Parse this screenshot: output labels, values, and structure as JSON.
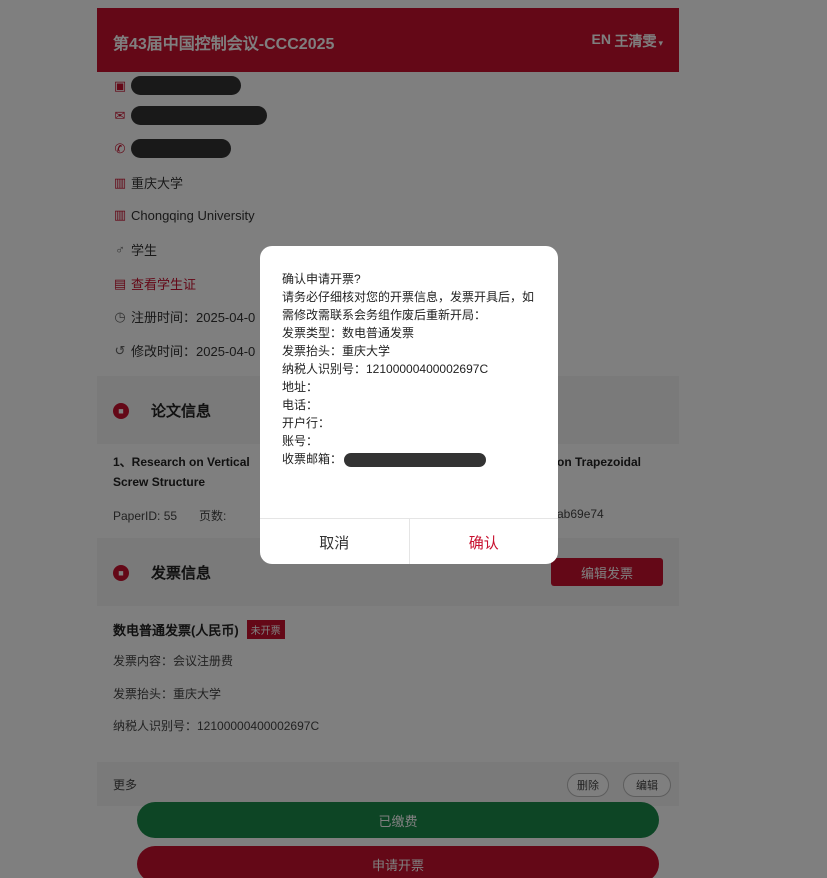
{
  "header": {
    "title": "第43届中国控制会议-CCC2025",
    "lang": "EN",
    "user": "王清雯",
    "caret": "▾"
  },
  "profile": {
    "affiliation_cn": "重庆大学",
    "affiliation_en": "Chongqing University",
    "role": "学生",
    "student_id_link": "查看学生证",
    "registered_time": "注册时间：2025-04-0",
    "modified_time": "修改时间：2025-04-0"
  },
  "paper": {
    "section_title": "论文信息",
    "title_line1": "1、Research on Vertical",
    "title_line1_right": "on Trapezoidal",
    "title_line2": "Screw Structure",
    "paper_id": "PaperID: 55",
    "pages": "页数:",
    "hash_tail": "ab69e74"
  },
  "invoice": {
    "section_title": "发票信息",
    "edit_button": "编辑发票",
    "type": "数电普通发票(人民币)",
    "status_badge": "未开票",
    "content": "发票内容：会议注册费",
    "header_line": "发票抬头：重庆大学",
    "tax_id": "纳税人识别号：12100000400002697C"
  },
  "actions": {
    "more": "更多",
    "delete": "删除",
    "edit": "编辑",
    "paid": "已缴费",
    "apply_invoice": "申请开票"
  },
  "dialog": {
    "title": "确认申请开票?",
    "notice": "请务必仔细核对您的开票信息，发票开具后，如需修改需联系会务组作废后重新开局：",
    "invoice_type": "发票类型：数电普通发票",
    "invoice_header": "发票抬头：重庆大学",
    "tax_id": "纳税人识别号：12100000400002697C",
    "address": "地址：",
    "phone": "电话：",
    "bank": "开户行：",
    "account": "账号：",
    "email_label": "收票邮箱：",
    "cancel": "取消",
    "confirm": "确认"
  },
  "colors": {
    "brand_red": "#c8102e",
    "paid_green": "#1b8a4b"
  }
}
